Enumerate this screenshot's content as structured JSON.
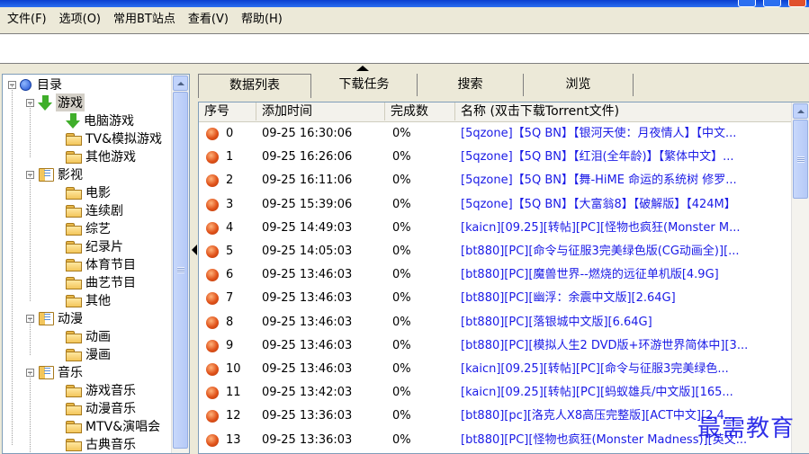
{
  "menu": [
    "文件(F)",
    "选项(O)",
    "常用BT站点",
    "查看(V)",
    "帮助(H)"
  ],
  "tree": [
    {
      "label": "目录",
      "icon": "globe-icon",
      "expander": "−"
    },
    {
      "label": "游戏",
      "icon": "arrow-down-icon",
      "expander": "−",
      "selected": true
    },
    {
      "label": "电脑游戏",
      "icon": "arrow-down-icon"
    },
    {
      "label": "TV&模拟游戏",
      "icon": "folder-icon"
    },
    {
      "label": "其他游戏",
      "icon": "folder-icon"
    },
    {
      "label": "影视",
      "icon": "book-icon",
      "expander": "−"
    },
    {
      "label": "电影",
      "icon": "folder-icon"
    },
    {
      "label": "连续剧",
      "icon": "folder-icon"
    },
    {
      "label": "综艺",
      "icon": "folder-icon"
    },
    {
      "label": "纪录片",
      "icon": "folder-icon"
    },
    {
      "label": "体育节目",
      "icon": "folder-icon"
    },
    {
      "label": "曲艺节目",
      "icon": "folder-icon"
    },
    {
      "label": "其他",
      "icon": "folder-icon"
    },
    {
      "label": "动漫",
      "icon": "book-icon",
      "expander": "−"
    },
    {
      "label": "动画",
      "icon": "folder-icon"
    },
    {
      "label": "漫画",
      "icon": "folder-icon"
    },
    {
      "label": "音乐",
      "icon": "book-icon",
      "expander": "−"
    },
    {
      "label": "游戏音乐",
      "icon": "folder-icon"
    },
    {
      "label": "动漫音乐",
      "icon": "folder-icon"
    },
    {
      "label": "MTV&演唱会",
      "icon": "folder-icon"
    },
    {
      "label": "古典音乐",
      "icon": "folder-icon"
    }
  ],
  "tabs": [
    "数据列表",
    "下载任务",
    "搜索",
    "浏览"
  ],
  "columns": [
    "序号",
    "添加时间",
    "完成数",
    "名称 (双击下载Torrent文件)"
  ],
  "rows": [
    {
      "id": "0",
      "time": "09-25 16:30:06",
      "done": "0%",
      "name": "[5qzone]【5Q BN】【银河天使：月夜情人】【中文..."
    },
    {
      "id": "1",
      "time": "09-25 16:26:06",
      "done": "0%",
      "name": "[5qzone]【5Q BN】【红泪(全年龄)】【繁体中文】..."
    },
    {
      "id": "2",
      "time": "09-25 16:11:06",
      "done": "0%",
      "name": "[5qzone]【5Q BN】【舞-HiME 命运的系统树 修罗..."
    },
    {
      "id": "3",
      "time": "09-25 15:39:06",
      "done": "0%",
      "name": "[5qzone]【5Q BN】【大富翁8】【破解版】【424M】"
    },
    {
      "id": "4",
      "time": "09-25 14:49:03",
      "done": "0%",
      "name": "[kaicn][09.25][转帖][PC][怪物也疯狂(Monster M..."
    },
    {
      "id": "5",
      "time": "09-25 14:05:03",
      "done": "0%",
      "name": "[bt880][PC][命令与征服3完美绿色版(CG动画全)][..."
    },
    {
      "id": "6",
      "time": "09-25 13:46:03",
      "done": "0%",
      "name": "[bt880][PC][魔兽世界--燃烧的远征单机版[4.9G]"
    },
    {
      "id": "7",
      "time": "09-25 13:46:03",
      "done": "0%",
      "name": "[bt880][PC][幽浮：余震中文版][2.64G]"
    },
    {
      "id": "8",
      "time": "09-25 13:46:03",
      "done": "0%",
      "name": "[bt880][PC][落银城中文版][6.64G]"
    },
    {
      "id": "9",
      "time": "09-25 13:46:03",
      "done": "0%",
      "name": "[bt880][PC][模拟人生2 DVD版+环游世界简体中][3..."
    },
    {
      "id": "10",
      "time": "09-25 13:46:03",
      "done": "0%",
      "name": "[kaicn][09.25][转帖][PC][命令与征服3完美绿色..."
    },
    {
      "id": "11",
      "time": "09-25 13:42:03",
      "done": "0%",
      "name": "[kaicn][09.25][转帖][PC][蚂蚁雄兵/中文版][165..."
    },
    {
      "id": "12",
      "time": "09-25 13:36:03",
      "done": "0%",
      "name": "[bt880][pc][洛克人X8高压完整版][ACT中文][2.4..."
    },
    {
      "id": "13",
      "time": "09-25 13:36:03",
      "done": "0%",
      "name": "[bt880][PC][怪物也疯狂(Monster Madness)][英文..."
    }
  ],
  "watermark": "最需教育"
}
